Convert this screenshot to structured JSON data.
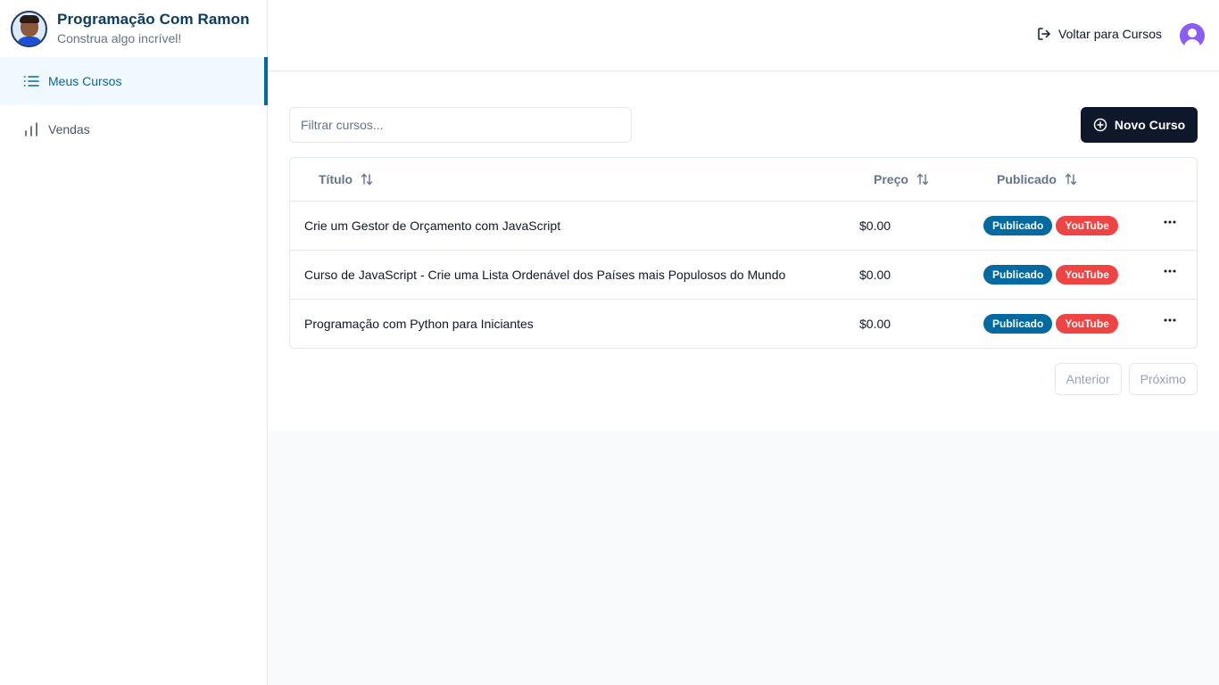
{
  "brand": {
    "title": "Programação Com Ramon",
    "subtitle": "Construa algo incrível!"
  },
  "sidebar": {
    "items": [
      {
        "label": "Meus Cursos",
        "icon": "list-icon",
        "active": true
      },
      {
        "label": "Vendas",
        "icon": "bar-chart-icon",
        "active": false
      }
    ]
  },
  "header": {
    "back_label": "Voltar para Cursos",
    "back_icon": "logout-icon",
    "user_icon": "user-avatar-icon"
  },
  "toolbar": {
    "filter_placeholder": "Filtrar cursos...",
    "filter_value": "",
    "new_course_label": "Novo Curso",
    "new_course_icon": "plus-circle-icon"
  },
  "table": {
    "columns": [
      {
        "label": "Título",
        "icon": "sort-icon"
      },
      {
        "label": "Preço",
        "icon": "sort-icon"
      },
      {
        "label": "Publicado",
        "icon": "sort-icon"
      }
    ],
    "rows": [
      {
        "title": "Crie um Gestor de Orçamento com JavaScript",
        "price": "$0.00",
        "status": "Publicado",
        "source": "YouTube"
      },
      {
        "title": "Curso de JavaScript - Crie uma Lista Ordenável dos Países mais Populosos do Mundo",
        "price": "$0.00",
        "status": "Publicado",
        "source": "YouTube"
      },
      {
        "title": "Programação com Python para Iniciantes",
        "price": "$0.00",
        "status": "Publicado",
        "source": "YouTube"
      }
    ]
  },
  "pagination": {
    "prev_label": "Anterior",
    "next_label": "Próximo"
  },
  "colors": {
    "accent": "#0369a1",
    "primary_button": "#0f172a",
    "badge_published": "#0369a1",
    "badge_youtube": "#ef4444",
    "avatar": "#8b5cf6"
  }
}
